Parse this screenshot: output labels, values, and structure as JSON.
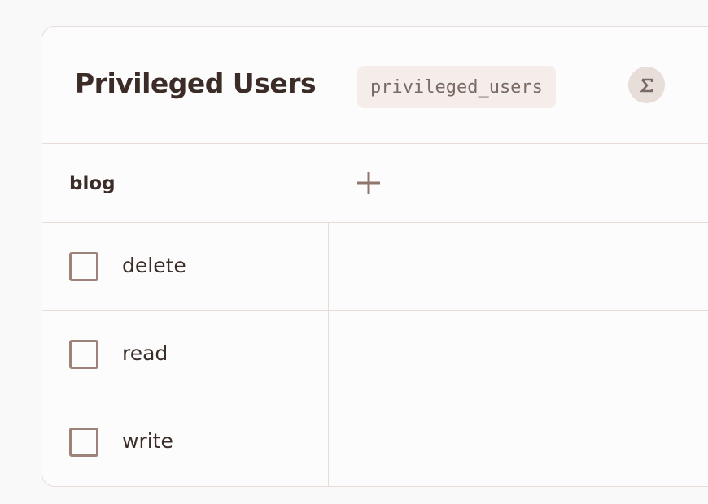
{
  "table": {
    "title": "Privileged Users",
    "code_name": "privileged_users",
    "summary_icon": "sigma-icon"
  },
  "group": {
    "label": "blog",
    "add_icon": "plus-icon"
  },
  "permissions": [
    {
      "label": "delete",
      "checked": false
    },
    {
      "label": "read",
      "checked": false
    },
    {
      "label": "write",
      "checked": false
    }
  ],
  "colors": {
    "text": "#3b2c28",
    "border": "#e6dcd8",
    "badge_bg": "#f5ede9",
    "checkbox_border": "#9c8278",
    "icon": "#8e766d"
  }
}
